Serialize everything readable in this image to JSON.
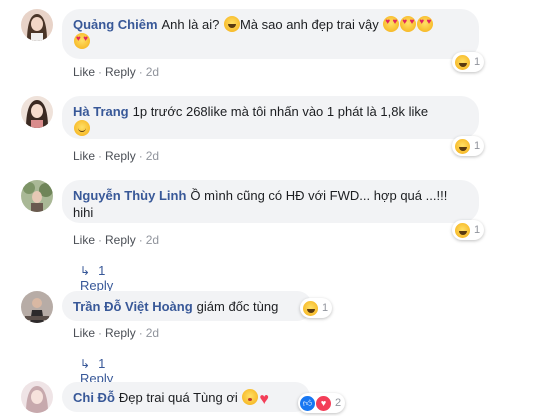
{
  "comments": [
    {
      "author": "Quảng Chiêm",
      "text": "Anh là ai? ",
      "text2": "Mà sao anh đẹp trai vậy",
      "emojis_inline": [
        "grinning-sweat",
        "heart-eyes",
        "heart-eyes",
        "heart-eyes",
        "heart-eyes"
      ],
      "actions": {
        "like": "Like",
        "reply": "Reply",
        "time": "2d"
      },
      "reactions": {
        "type": "haha",
        "count": "1"
      },
      "avatar_colors": [
        "#d7b9a8",
        "#4a3528"
      ]
    },
    {
      "author": "Hà Trang",
      "text": "1p trước 268like mà tôi nhấn vào 1 phát là 1,8k like",
      "emojis_inline": [
        "smile"
      ],
      "actions": {
        "like": "Like",
        "reply": "Reply",
        "time": "2d"
      },
      "reactions": {
        "type": "haha",
        "count": "1"
      },
      "avatar_colors": [
        "#e9c8b8",
        "#3b2a22"
      ]
    },
    {
      "author": "Nguyễn Thùy Linh",
      "text": "Ồ mình cũng có HĐ với FWD... hợp quá ...!!! hihi",
      "actions": {
        "like": "Like",
        "reply": "Reply",
        "time": "2d"
      },
      "reactions": {
        "type": "haha",
        "count": "1"
      },
      "replies_link": "1 Reply",
      "avatar_colors": [
        "#8fa880",
        "#5d6b4c"
      ]
    },
    {
      "author": "Trần Đỗ Việt Hoàng",
      "text": "giám đốc tùng",
      "actions": {
        "like": "Like",
        "reply": "Reply",
        "time": "2d"
      },
      "reactions": {
        "type": "haha",
        "count": "1"
      },
      "replies_link": "1 Reply",
      "avatar_colors": [
        "#9a8d86",
        "#2d2a2b"
      ]
    },
    {
      "author": "Chi Đỗ",
      "text": "Đẹp trai quá Tùng ơi",
      "emojis_inline": [
        "kiss",
        "red-heart"
      ],
      "reactions": {
        "type": "like-love",
        "count": "2"
      },
      "avatar_colors": [
        "#e4d4d6",
        "#bda0a4"
      ]
    }
  ]
}
